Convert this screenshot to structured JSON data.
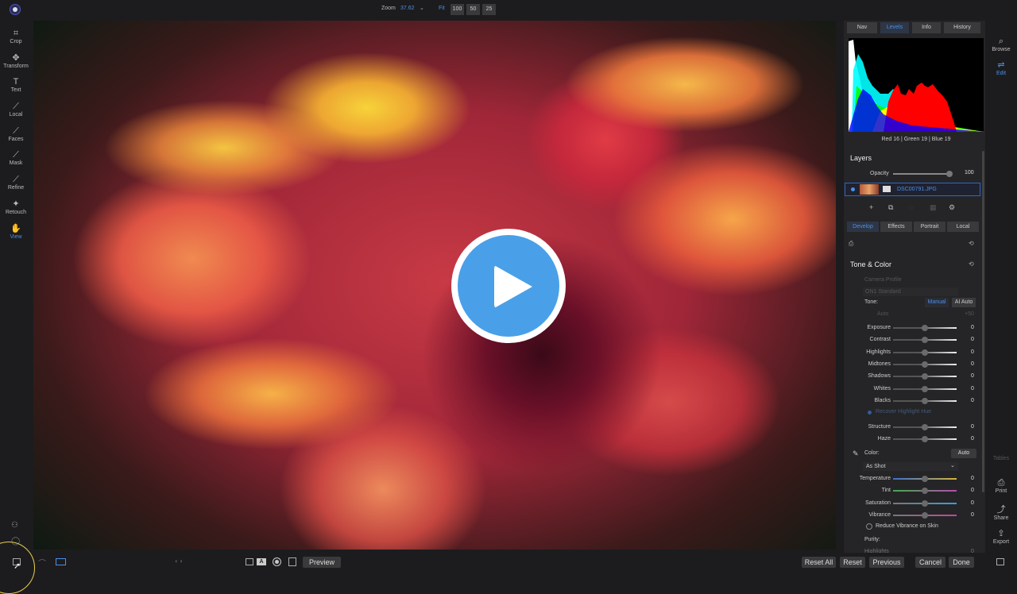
{
  "topbar": {
    "zoom_label": "Zoom",
    "zoom_value": "37.62",
    "fit_label": "Fit",
    "zoom_presets": [
      "100",
      "50",
      "25"
    ]
  },
  "left_tools": [
    {
      "label": "Crop",
      "icon": "crop-icon",
      "glyph": "⌗"
    },
    {
      "label": "Transform",
      "icon": "transform-icon",
      "glyph": "✥"
    },
    {
      "label": "Text",
      "icon": "text-icon",
      "glyph": "T"
    },
    {
      "label": "Local",
      "icon": "local-brush-icon",
      "glyph": "⟋"
    },
    {
      "label": "Faces",
      "icon": "faces-icon",
      "glyph": "⟋"
    },
    {
      "label": "Mask",
      "icon": "mask-icon",
      "glyph": "⟋"
    },
    {
      "label": "Refine",
      "icon": "refine-icon",
      "glyph": "⟋"
    },
    {
      "label": "Retouch",
      "icon": "retouch-icon",
      "glyph": "✦"
    },
    {
      "label": "View",
      "icon": "view-icon",
      "glyph": "✋",
      "active": true
    }
  ],
  "panel_tabs": [
    {
      "label": "Nav",
      "active": false
    },
    {
      "label": "Levels",
      "active": true
    },
    {
      "label": "Info",
      "active": false
    },
    {
      "label": "History",
      "active": false
    }
  ],
  "histogram": {
    "red_label": "Red",
    "red": "16",
    "green_label": "Green",
    "green": "19",
    "blue_label": "Blue",
    "blue": "19"
  },
  "layers": {
    "header": "Layers",
    "opacity_label": "Opacity",
    "opacity_value": "100",
    "opacity_fraction": 0.95,
    "layer_name": "DSC00791.JPG"
  },
  "section_tabs": [
    {
      "label": "Develop",
      "active": true
    },
    {
      "label": "Effects",
      "active": false
    },
    {
      "label": "Portrait",
      "active": false
    },
    {
      "label": "Local",
      "active": false
    }
  ],
  "tone_color": {
    "header": "Tone & Color",
    "camera_profile_label": "Camera Profile",
    "camera_profile_value": "ON1 Standard",
    "tone_label": "Tone:",
    "manual_label": "Manual",
    "ai_auto_label": "AI Auto",
    "auto_label": "Auto",
    "auto_value": "+50",
    "tone_sliders": [
      {
        "label": "Exposure",
        "value": "0",
        "fraction": 0.5
      },
      {
        "label": "Contrast",
        "value": "0",
        "fraction": 0.5
      },
      {
        "label": "Highlights",
        "value": "0",
        "fraction": 0.5
      },
      {
        "label": "Midtones",
        "value": "0",
        "fraction": 0.5
      },
      {
        "label": "Shadows",
        "value": "0",
        "fraction": 0.5
      },
      {
        "label": "Whites",
        "value": "0",
        "fraction": 0.5
      },
      {
        "label": "Blacks",
        "value": "0",
        "fraction": 0.5
      }
    ],
    "recover_highlight_label": "Recover Highlight Hue",
    "detail_sliders": [
      {
        "label": "Structure",
        "value": "0",
        "fraction": 0.5
      },
      {
        "label": "Haze",
        "value": "0",
        "fraction": 0.5
      }
    ],
    "color_label": "Color:",
    "color_auto_label": "Auto",
    "wb_value": "As Shot",
    "color_sliders": [
      {
        "label": "Temperature",
        "value": "0",
        "fraction": 0.5,
        "gradient": [
          "#3b6fd1",
          "#d6b43a"
        ]
      },
      {
        "label": "Tint",
        "value": "0",
        "fraction": 0.5,
        "gradient": [
          "#3fae4a",
          "#b84ab0"
        ]
      },
      {
        "label": "Saturation",
        "value": "0",
        "fraction": 0.5,
        "gradient": [
          "#777777",
          "#3a9ed8"
        ]
      },
      {
        "label": "Vibrance",
        "value": "0",
        "fraction": 0.5,
        "gradient": [
          "#777777",
          "#c0489a"
        ]
      }
    ],
    "reduce_vibrance_label": "Reduce Vibrance on Skin",
    "purity_label": "Purity:",
    "purity_highlights_label": "Highlights",
    "purity_highlights_value": "0"
  },
  "right_column": [
    {
      "label": "Browse",
      "icon": "browse-icon",
      "glyph": "⌕",
      "state": "normal"
    },
    {
      "label": "Edit",
      "icon": "edit-icon",
      "glyph": "⇌",
      "state": "active"
    }
  ],
  "right_column_bottom": [
    {
      "label": "Tables",
      "icon": "tables-icon",
      "glyph": "",
      "state": "dim"
    },
    {
      "label": "Print",
      "icon": "print-icon",
      "glyph": "⎙",
      "state": "normal"
    },
    {
      "label": "Share",
      "icon": "share-icon",
      "glyph": "⤴",
      "state": "normal"
    },
    {
      "label": "Export",
      "icon": "export-icon",
      "glyph": "⇪",
      "state": "normal"
    }
  ],
  "bottombar": {
    "preview_label": "Preview",
    "reset_all_label": "Reset All",
    "reset_label": "Reset",
    "previous_label": "Previous",
    "cancel_label": "Cancel",
    "done_label": "Done"
  },
  "colors": {
    "accent": "#4a8fe8",
    "play_button": "#49a0e8"
  }
}
